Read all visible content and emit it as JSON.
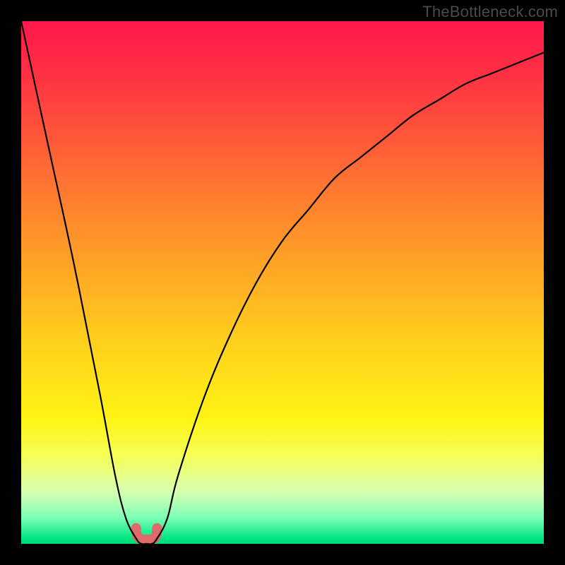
{
  "watermark": "TheBottleneck.com",
  "chart_data": {
    "type": "line",
    "title": "",
    "xlabel": "",
    "ylabel": "",
    "xlim": [
      0,
      100
    ],
    "ylim": [
      0,
      100
    ],
    "grid": false,
    "x": [
      0,
      5,
      10,
      15,
      18,
      20,
      22,
      23,
      24,
      25,
      26,
      28,
      30,
      35,
      40,
      45,
      50,
      55,
      60,
      65,
      70,
      75,
      80,
      85,
      90,
      95,
      100
    ],
    "values": [
      100,
      77,
      54,
      29,
      13,
      5,
      1,
      0,
      0,
      0,
      1,
      5,
      13,
      28,
      40,
      50,
      58,
      64,
      70,
      74,
      78,
      82,
      85,
      88,
      90,
      92,
      94
    ],
    "accent_region": {
      "x_start": 22,
      "x_end": 26,
      "y_max": 3
    },
    "colors": {
      "curve": "#000000",
      "accent": "#e06a6a",
      "gradient_top": "#ff1a4d",
      "gradient_bottom": "#00d877"
    }
  }
}
